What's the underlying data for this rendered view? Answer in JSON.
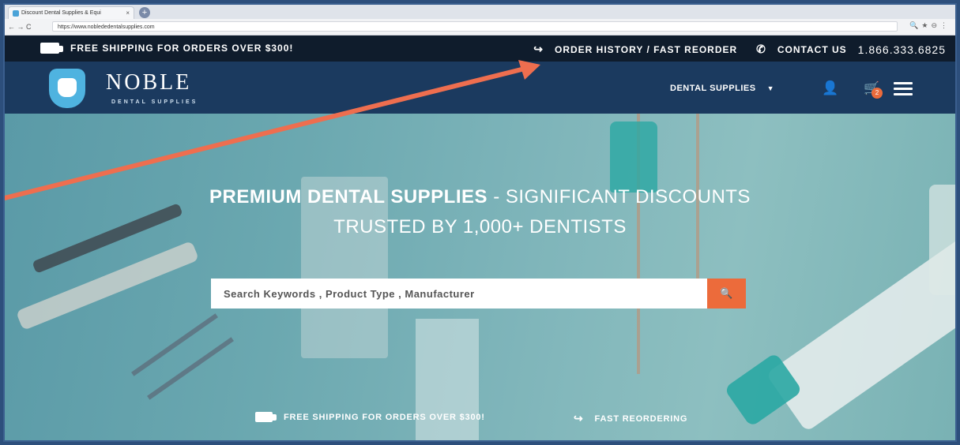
{
  "browser": {
    "tab_title": "Discount Dental Supplies & Equi",
    "tab_close": "×",
    "new_tab": "+",
    "nav_buttons": "← → C",
    "url": "https://www.noblededentalsupplies.com",
    "right_icons": "🔍★⊖⋮"
  },
  "topbar": {
    "free_shipping": "FREE SHIPPING FOR ORDERS OVER $300!",
    "order_history": "ORDER HISTORY / FAST REORDER",
    "contact_us": "CONTACT US",
    "phone": "1.866.333.6825",
    "reorder_icon": "↪",
    "phone_icon": "✆"
  },
  "header": {
    "logo_name": "NOBLE",
    "logo_sub": "DENTAL SUPPLIES",
    "dental_supplies": "DENTAL SUPPLIES",
    "dropdown_caret": "▼",
    "user_glyph": "👤",
    "cart_glyph": "🛒",
    "cart_count": "2"
  },
  "hero": {
    "title_bold": "PREMIUM DENTAL SUPPLIES",
    "title_rest": " - SIGNIFICANT DISCOUNTS",
    "subtitle": "TRUSTED BY 1,000+ DENTISTS",
    "search_placeholder": "Search Keywords , Product Type , Manufacturer",
    "search_button_glyph": "🔍",
    "feature_shipping": "FREE SHIPPING FOR ORDERS OVER $300!",
    "feature_reorder": "FAST REORDERING",
    "feature_reorder_icon": "↪"
  },
  "colors": {
    "accent_orange": "#ec6b3b",
    "header_navy": "#1b3a5f",
    "topbar_dark": "#0f1c2c",
    "annotation_arrow": "#ee6e4f"
  }
}
